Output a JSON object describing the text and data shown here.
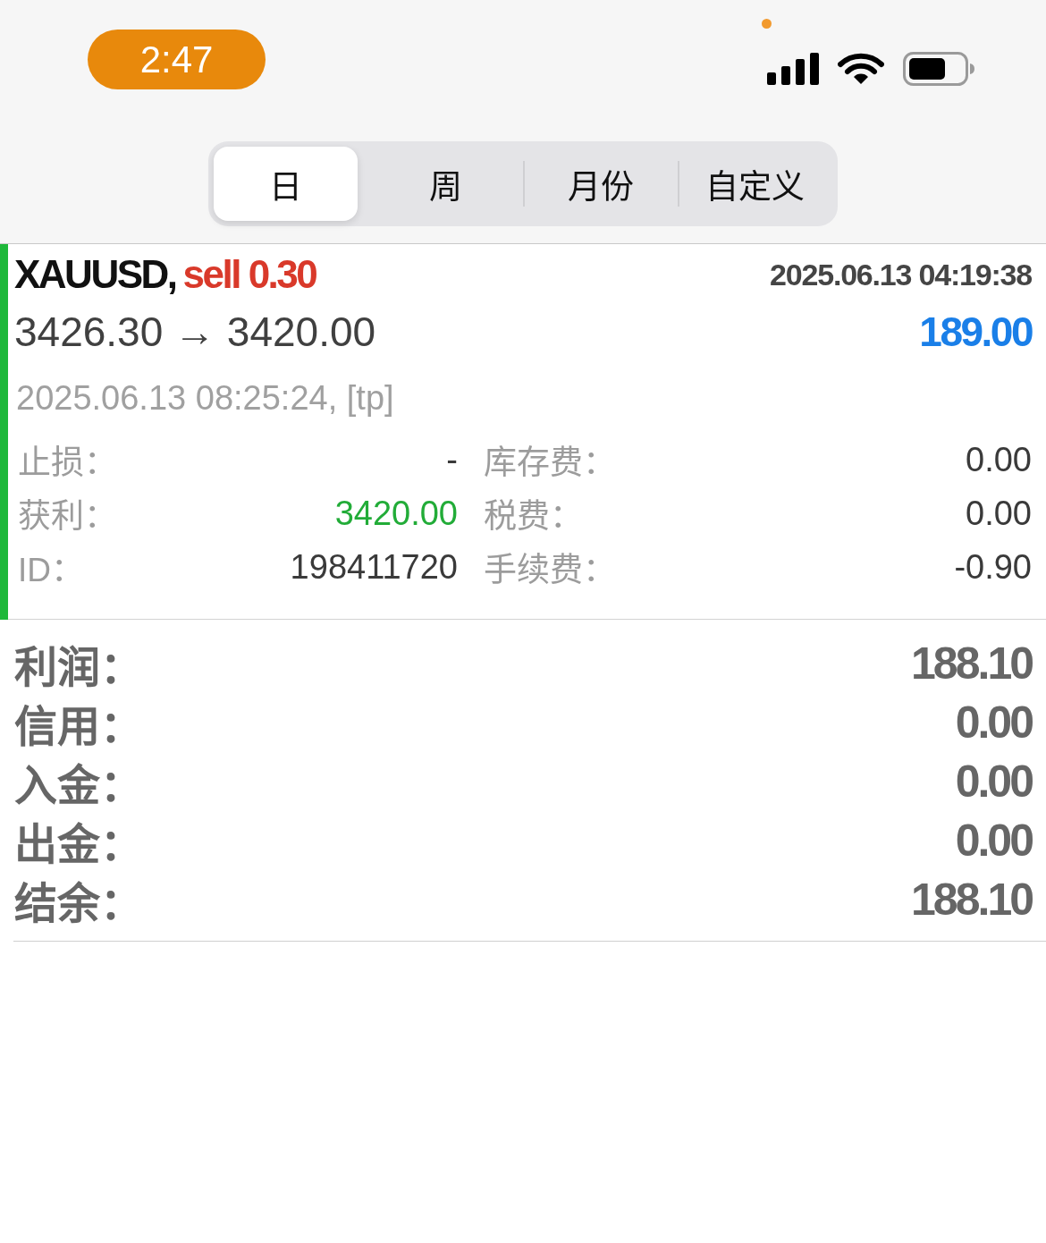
{
  "status_bar": {
    "time": "2:47"
  },
  "period_tabs": [
    {
      "label": "日",
      "selected": true
    },
    {
      "label": "周",
      "selected": false
    },
    {
      "label": "月份",
      "selected": false
    },
    {
      "label": "自定义",
      "selected": false
    }
  ],
  "trade": {
    "symbol": "XAUUSD,",
    "order": "sell 0.30",
    "open_time": "2025.06.13 04:19:38",
    "prices": "3426.30 → 3420.00",
    "profit": "189.00",
    "close_info": "2025.06.13 08:25:24, [tp]",
    "detail_rows": [
      {
        "left": {
          "label": "止损：",
          "value": "-",
          "color": "#3a3a3a"
        },
        "right": {
          "label": "库存费：",
          "value": "0.00",
          "color": "#3a3a3a"
        }
      },
      {
        "left": {
          "label": "获利：",
          "value": "3420.00",
          "color": "#22ac38"
        },
        "right": {
          "label": "税费：",
          "value": "0.00",
          "color": "#3a3a3a"
        }
      },
      {
        "left": {
          "label": "ID：",
          "value": "198411720",
          "color": "#3a3a3a"
        },
        "right": {
          "label": "手续费：",
          "value": "-0.90",
          "color": "#3a3a3a"
        }
      }
    ]
  },
  "summary": [
    {
      "label": "利润：",
      "value": "188.10"
    },
    {
      "label": "信用：",
      "value": "0.00"
    },
    {
      "label": "入金：",
      "value": "0.00"
    },
    {
      "label": "出金：",
      "value": "0.00"
    },
    {
      "label": "结余：",
      "value": "188.10"
    }
  ]
}
